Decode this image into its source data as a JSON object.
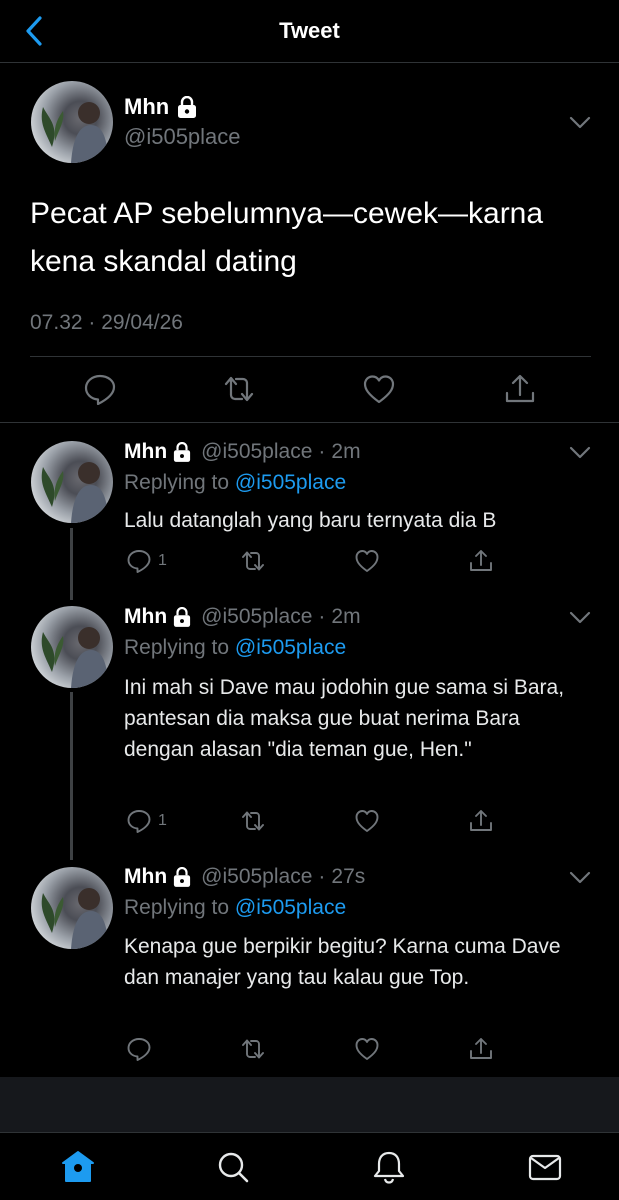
{
  "header": {
    "title": "Tweet"
  },
  "main_tweet": {
    "name": "Mhn",
    "handle": "@i505place",
    "text": "Pecat AP sebelumnya—cewek—karna kena skandal dating",
    "timestamp": "07.32 · 29/04/26"
  },
  "replies": [
    {
      "name": "Mhn",
      "handle": "@i505place",
      "time": "2m",
      "replying_label": "Replying to",
      "replying_to": "@i505place",
      "text": "Lalu datanglah yang baru ternyata dia B",
      "reply_count": "1"
    },
    {
      "name": "Mhn",
      "handle": "@i505place",
      "time": "2m",
      "replying_label": "Replying to",
      "replying_to": "@i505place",
      "text": "Ini mah si Dave mau jodohin gue sama si Bara, pantesan dia maksa gue buat nerima Bara dengan alasan \"dia teman gue, Hen.\"",
      "reply_count": "1"
    },
    {
      "name": "Mhn",
      "handle": "@i505place",
      "time": "27s",
      "replying_label": "Replying to",
      "replying_to": "@i505place",
      "text": "Kenapa gue berpikir begitu? Karna cuma Dave dan manajer yang tau kalau gue Top.",
      "reply_count": ""
    }
  ],
  "colors": {
    "background": "#000000",
    "accent": "#1d9bf0",
    "muted": "#71767b",
    "divider": "#2f3336"
  },
  "icons": {
    "back": "chevron-left-icon",
    "lock": "lock-icon",
    "more": "chevron-down-icon",
    "reply": "reply-icon",
    "retweet": "retweet-icon",
    "like": "heart-icon",
    "share": "share-icon",
    "tabs": [
      "home-icon",
      "search-icon",
      "notifications-icon",
      "messages-icon"
    ]
  }
}
